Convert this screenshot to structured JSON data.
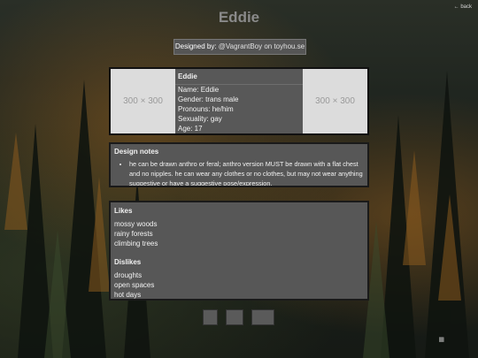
{
  "nav": {
    "back_label": "← back"
  },
  "page": {
    "title": "Eddie"
  },
  "credit": {
    "prefix": "Designed by:",
    "handle": "@VagrantBoy on toyhou.se"
  },
  "images": {
    "left_placeholder": "300 × 300",
    "right_placeholder": "300 × 300"
  },
  "info": {
    "name_heading": "Eddie",
    "name": "Name: Eddie",
    "gender": "Gender: trans male",
    "pronouns": "Pronouns: he/him",
    "sexuality": "Sexuality: gay",
    "age": "Age: 17"
  },
  "design_notes": {
    "heading": "Design notes",
    "items": [
      "he can be drawn anthro or feral; anthro version MUST be drawn with a flat chest and no nipples. he can wear any clothes or no clothes, but may not wear anything suggestive or have a suggestive pose/expression."
    ]
  },
  "likes": {
    "heading": "Likes",
    "items": [
      "mossy woods",
      "rainy forests",
      "climbing trees"
    ]
  },
  "dislikes": {
    "heading": "Dislikes",
    "items": [
      "droughts",
      "open spaces",
      "hot days"
    ]
  },
  "icons": {
    "corner": "image-icon"
  },
  "colors": {
    "panel": "#575757",
    "placeholder": "#dcdcdc",
    "title": "#8a8a8a"
  }
}
